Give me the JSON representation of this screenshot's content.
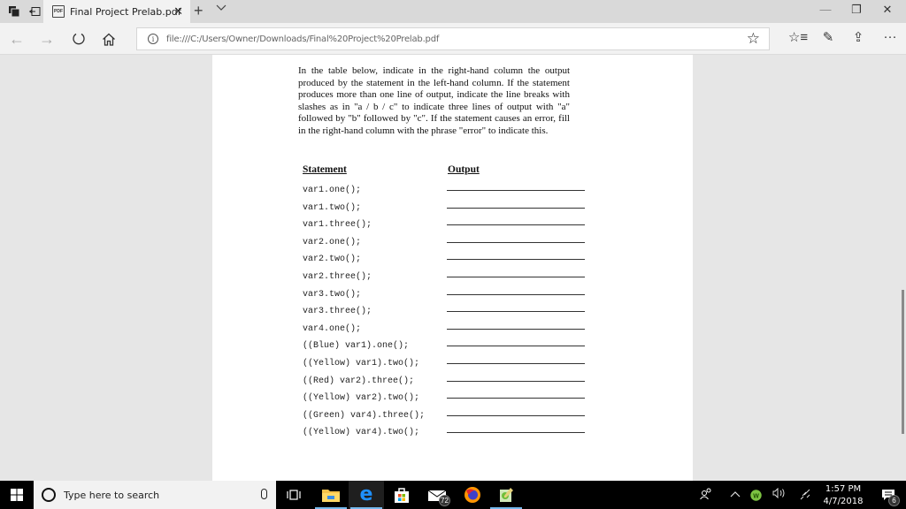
{
  "browser": {
    "tab": {
      "title": "Final Project Prelab.pdf",
      "close": "✕",
      "icon": "pdf-icon"
    },
    "new_tab": "+",
    "tab_list": "⌄",
    "window_controls": {
      "minimize": "—",
      "restore": "❐",
      "close": "✕"
    },
    "nav": {
      "back": "←",
      "forward": "→",
      "refresh": "↻",
      "home": "⌂"
    },
    "address": {
      "info": "i",
      "url": "file:///C:/Users/Owner/Downloads/Final%20Project%20Prelab.pdf",
      "favorite": "☆"
    },
    "toolbar": {
      "favorites": "☆≡",
      "notes": "✎",
      "share": "⇪",
      "more": "···"
    }
  },
  "document": {
    "intro": "In the table below, indicate in the right-hand column the output produced by the statement in the left-hand column.  If the statement produces more than one line of output, indicate the line breaks with slashes as in \"a / b / c\" to indicate three lines of output with \"a\" followed by \"b\" followed by \"c\".  If the statement causes an error, fill in the right-hand column with the phrase \"error\" to indicate this.",
    "headers": {
      "statement": "Statement",
      "output": "Output"
    },
    "rows": [
      {
        "statement": "var1.one();",
        "output": ""
      },
      {
        "statement": "var1.two();",
        "output": ""
      },
      {
        "statement": "var1.three();",
        "output": ""
      },
      {
        "statement": "var2.one();",
        "output": ""
      },
      {
        "statement": "var2.two();",
        "output": ""
      },
      {
        "statement": "var2.three();",
        "output": ""
      },
      {
        "statement": "var3.two();",
        "output": ""
      },
      {
        "statement": "var3.three();",
        "output": ""
      },
      {
        "statement": "var4.one();",
        "output": ""
      },
      {
        "statement": "((Blue) var1).one();",
        "output": ""
      },
      {
        "statement": "((Yellow) var1).two();",
        "output": ""
      },
      {
        "statement": "((Red) var2).three();",
        "output": ""
      },
      {
        "statement": "((Yellow) var2).two();",
        "output": ""
      },
      {
        "statement": "((Green) var4).three();",
        "output": ""
      },
      {
        "statement": "((Yellow) var4).two();",
        "output": ""
      }
    ]
  },
  "taskbar": {
    "search_placeholder": "Type here to search",
    "mail_badge": "72",
    "time": "1:57 PM",
    "date": "4/7/2018",
    "notifications_badge": "6",
    "tray_icons": [
      "people-icon",
      "chevron-up-icon",
      "webroot-icon",
      "volume-icon",
      "network-icon"
    ]
  }
}
